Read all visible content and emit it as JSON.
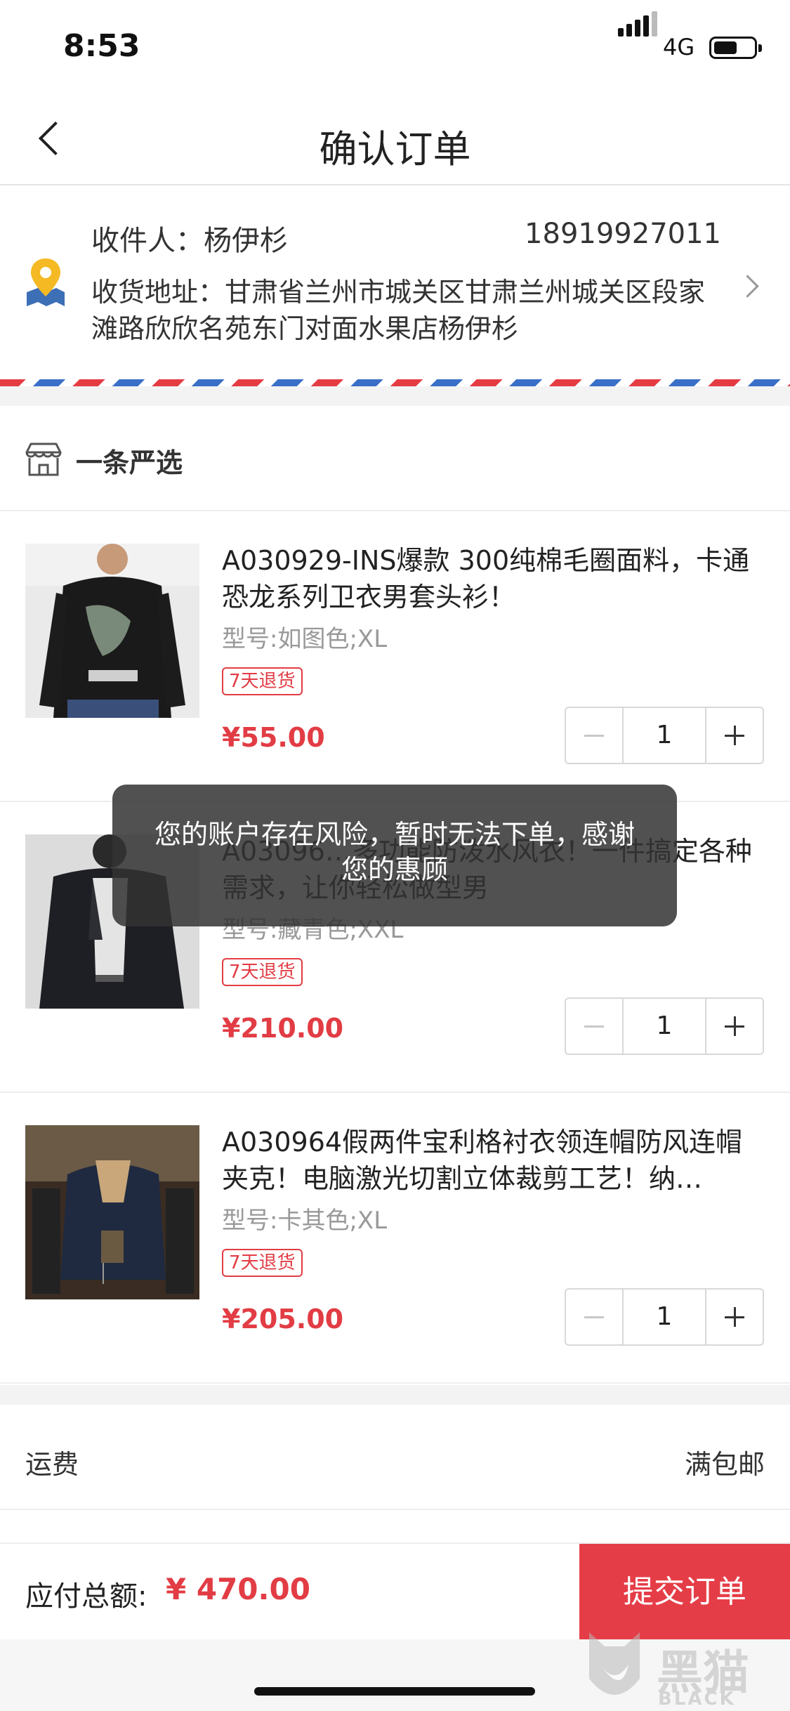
{
  "status": {
    "time": "8:53",
    "network": "4G"
  },
  "nav": {
    "title": "确认订单"
  },
  "address": {
    "recipient": "收件人：杨伊杉",
    "phone": "18919927011",
    "address": "收货地址：甘肃省兰州市城关区甘肃兰州城关区段家滩路欣欣名苑东门对面水果店杨伊杉"
  },
  "shop": {
    "name": "一条严选"
  },
  "items": [
    {
      "title": "A030929-INS爆款 300纯棉毛圈面料，卡通恐龙系列卫衣男套头衫！",
      "spec": "型号:如图色;XL",
      "badge": "7天退货",
      "price": "¥55.00",
      "qty": "1"
    },
    {
      "title": "A03096…多功能防泼水风衣！一件搞定各种需求，让你轻松做型男",
      "spec": "型号:藏青色;XXL",
      "badge": "7天退货",
      "price": "¥210.00",
      "qty": "1"
    },
    {
      "title": "A030964假两件宝利格衬衣领连帽防风连帽夹克！电脑激光切割立体裁剪工艺！纳…",
      "spec": "型号:卡其色;XL",
      "badge": "7天退货",
      "price": "¥205.00",
      "qty": "1"
    }
  ],
  "shipping": {
    "label": "运费",
    "value": "满包邮"
  },
  "footer": {
    "total_label": "应付总额:",
    "total_value": "¥ 470.00",
    "submit_label": "提交订单"
  },
  "toast": {
    "message": "您的账户存在风险，暂时无法下单，感谢您的惠顾"
  },
  "watermark": {
    "cn": "黑猫",
    "en": "BLACK CAT"
  },
  "colors": {
    "accent": "#e53d47",
    "price": "#e23c44"
  }
}
